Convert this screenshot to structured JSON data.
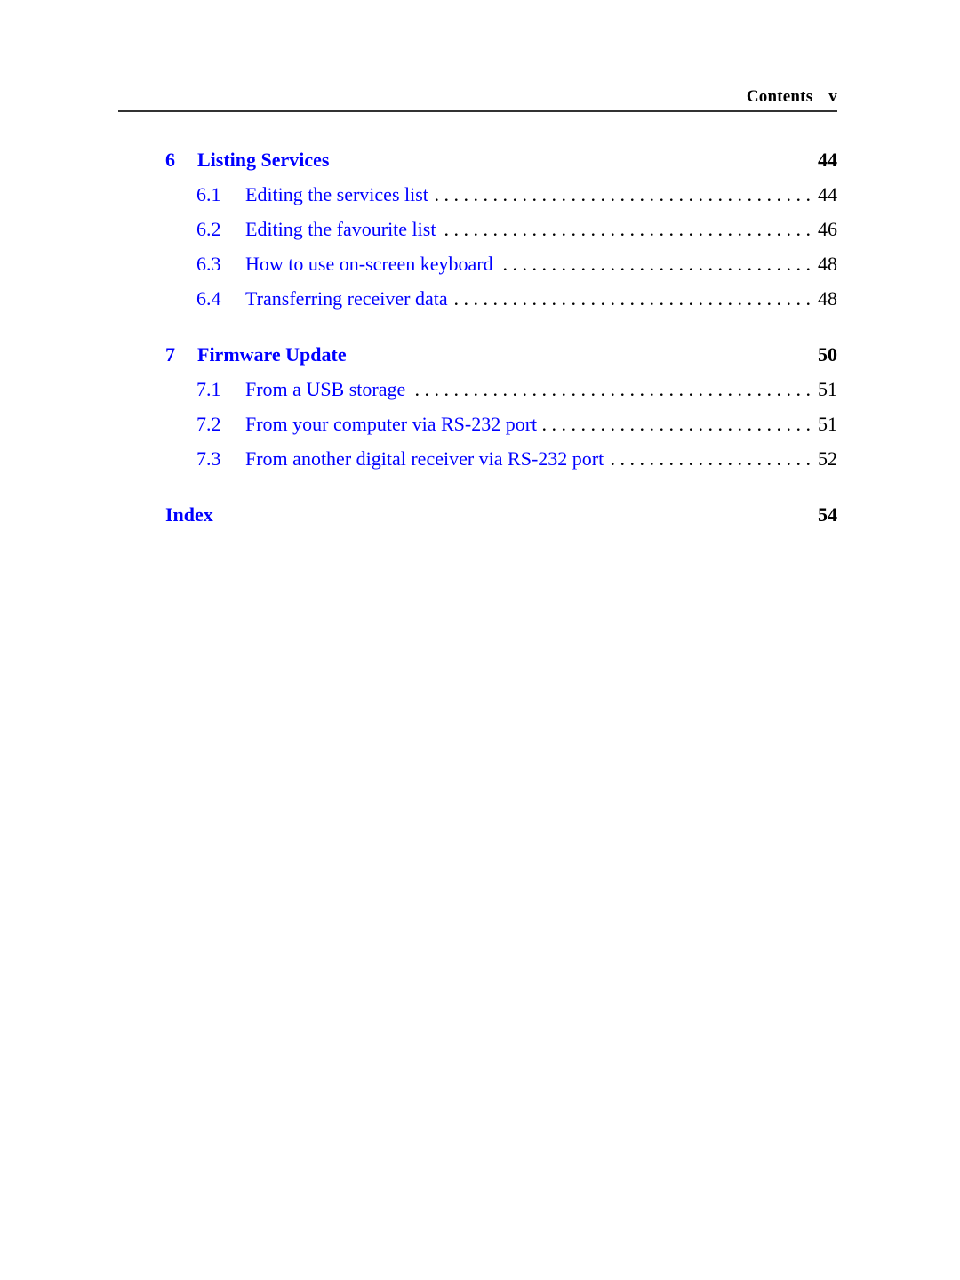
{
  "header": {
    "title": "Contents",
    "page_number": "v"
  },
  "toc": {
    "chapters": [
      {
        "number": "6",
        "title": "Listing Services",
        "page": "44",
        "sections": [
          {
            "number": "6.1",
            "title": "Editing the services list",
            "page": "44"
          },
          {
            "number": "6.2",
            "title": "Editing the favourite list",
            "page": "46"
          },
          {
            "number": "6.3",
            "title": "How to use on-screen keyboard",
            "page": "48"
          },
          {
            "number": "6.4",
            "title": "Transferring receiver data",
            "page": "48"
          }
        ]
      },
      {
        "number": "7",
        "title": "Firmware Update",
        "page": "50",
        "sections": [
          {
            "number": "7.1",
            "title": "From a USB storage",
            "page": "51"
          },
          {
            "number": "7.2",
            "title": "From your computer via RS-232 port",
            "page": "51"
          },
          {
            "number": "7.3",
            "title": "From another digital receiver via RS-232 port",
            "page": "52"
          }
        ]
      }
    ],
    "index": {
      "title": "Index",
      "page": "54"
    }
  },
  "colors": {
    "link": "#0000ff",
    "text": "#000000"
  }
}
